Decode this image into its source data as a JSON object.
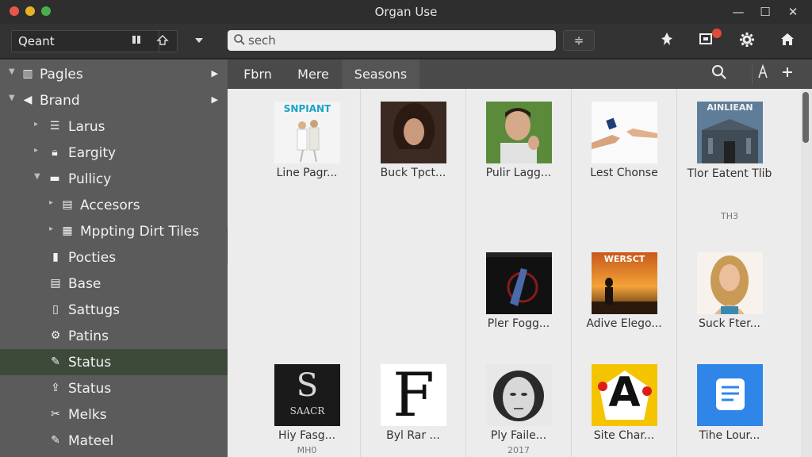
{
  "window": {
    "title": "Organ Use",
    "minimize": "—",
    "maximize": "☐",
    "close": "✕"
  },
  "toolbar": {
    "location_text": "Qeant",
    "search_placeholder": "sech",
    "search_value": "",
    "filter_label": "≑"
  },
  "sidebar": {
    "items": [
      {
        "label": "Pagles",
        "icon": "pages-icon",
        "depth": 0,
        "expanded": true,
        "right": "▶"
      },
      {
        "label": "Brand",
        "icon": "tag-icon",
        "depth": 0,
        "expanded": true,
        "right": "▶"
      },
      {
        "label": "Larus",
        "icon": "list-icon",
        "depth": 1,
        "expanded": false
      },
      {
        "label": "Eargity",
        "icon": "lock-icon",
        "depth": 1,
        "expanded": false
      },
      {
        "label": "Pullicy",
        "icon": "folder-icon",
        "depth": 1,
        "expanded": true
      },
      {
        "label": "Accesors",
        "icon": "document-icon",
        "depth": 2,
        "expanded": false
      },
      {
        "label": "Mppting Dirt Tiles",
        "icon": "grid-icon",
        "depth": 2,
        "expanded": false
      },
      {
        "label": "Pocties",
        "icon": "page-icon",
        "depth": 2
      },
      {
        "label": "Base",
        "icon": "stack-icon",
        "depth": 2
      },
      {
        "label": "Sattugs",
        "icon": "file-icon",
        "depth": 2
      },
      {
        "label": "Patins",
        "icon": "gear-icon",
        "depth": 2
      },
      {
        "label": "Status",
        "icon": "pen-icon",
        "depth": 2,
        "active": true
      },
      {
        "label": "Status",
        "icon": "export-icon",
        "depth": 2
      },
      {
        "label": "Melks",
        "icon": "tool-icon",
        "depth": 2
      },
      {
        "label": "Mateel",
        "icon": "pen-icon",
        "depth": 2
      }
    ]
  },
  "tabs": [
    {
      "label": "Fbrn"
    },
    {
      "label": "Mere"
    },
    {
      "label": "Seasons",
      "selected": true
    }
  ],
  "grid": {
    "tiles": [
      {
        "label": "Line Pagr...",
        "sub": "",
        "thumb": "poster-couple"
      },
      {
        "label": "Buck Tpct...",
        "sub": "",
        "thumb": "portrait-woman"
      },
      {
        "label": "Pulir Lagg...",
        "sub": "",
        "thumb": "portrait-man"
      },
      {
        "label": "Lest Chonse",
        "sub": "",
        "thumb": "hands"
      },
      {
        "label": "Tlor Eatent Tlib",
        "sub": "TH3",
        "thumb": "building"
      },
      {
        "label": "Pler Fogg...",
        "sub": "",
        "thumb": "poster-dark"
      },
      {
        "label": "Adive Elego...",
        "sub": "",
        "thumb": "sunset"
      },
      {
        "label": "Suck Fter...",
        "sub": "",
        "thumb": "portrait-blonde"
      },
      {
        "label": "Hiy Fasg...",
        "sub": "MH0",
        "thumb": "logo-s"
      },
      {
        "label": "Byl Rar ...",
        "sub": "",
        "thumb": "letter-f"
      },
      {
        "label": "Ply Faile...",
        "sub": "2017",
        "thumb": "sketch-face"
      },
      {
        "label": "Site Char...",
        "sub": "",
        "thumb": "letter-a"
      },
      {
        "label": "Tihe Lour...",
        "sub": "",
        "thumb": "doc-app"
      }
    ],
    "thumb_texts": {
      "t0": "SNPIANT",
      "t4": "AINLIEAN",
      "t6": "WERSCT",
      "t8a": "S",
      "t8b": "SAACR",
      "t9": "F",
      "t11": "A"
    }
  },
  "colors": {
    "sidebar_bg": "#5b5b5b",
    "sidebar_active": "#3d4a3a",
    "content_bg": "#ececec",
    "accent_blue": "#2f86e8",
    "accent_yellow": "#f5c400"
  }
}
